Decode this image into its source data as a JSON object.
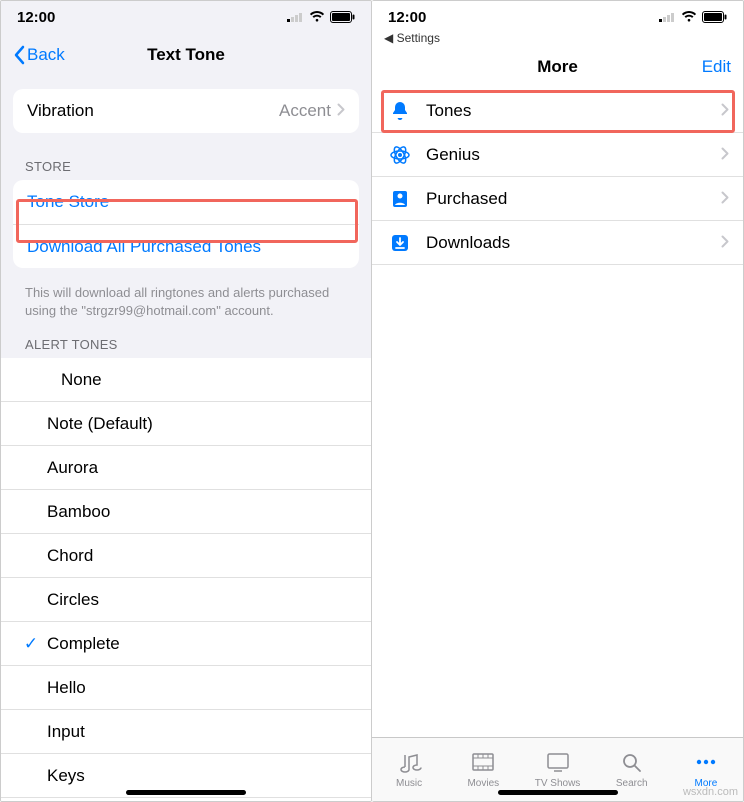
{
  "status": {
    "time": "12:00"
  },
  "left": {
    "nav": {
      "back": "Back",
      "title": "Text Tone"
    },
    "vibration": {
      "label": "Vibration",
      "value": "Accent"
    },
    "store": {
      "header": "STORE",
      "tone_store": "Tone Store",
      "download_all": "Download All Purchased Tones",
      "footer": "This will download all ringtones and alerts purchased using the \"strgzr99@hotmail.com\" account."
    },
    "alert_header": "ALERT TONES",
    "tones": [
      "None",
      "Note (Default)",
      "Aurora",
      "Bamboo",
      "Chord",
      "Circles",
      "Complete",
      "Hello",
      "Input",
      "Keys"
    ],
    "selected_tone": "Complete"
  },
  "right": {
    "back_crumb": "Settings",
    "nav": {
      "title": "More",
      "edit": "Edit"
    },
    "items": [
      {
        "label": "Tones",
        "icon": "bell"
      },
      {
        "label": "Genius",
        "icon": "atom"
      },
      {
        "label": "Purchased",
        "icon": "purchased"
      },
      {
        "label": "Downloads",
        "icon": "download"
      }
    ],
    "tabs": [
      {
        "label": "Music"
      },
      {
        "label": "Movies"
      },
      {
        "label": "TV Shows"
      },
      {
        "label": "Search"
      },
      {
        "label": "More",
        "active": true
      }
    ]
  },
  "watermark": "wsxdn.com"
}
